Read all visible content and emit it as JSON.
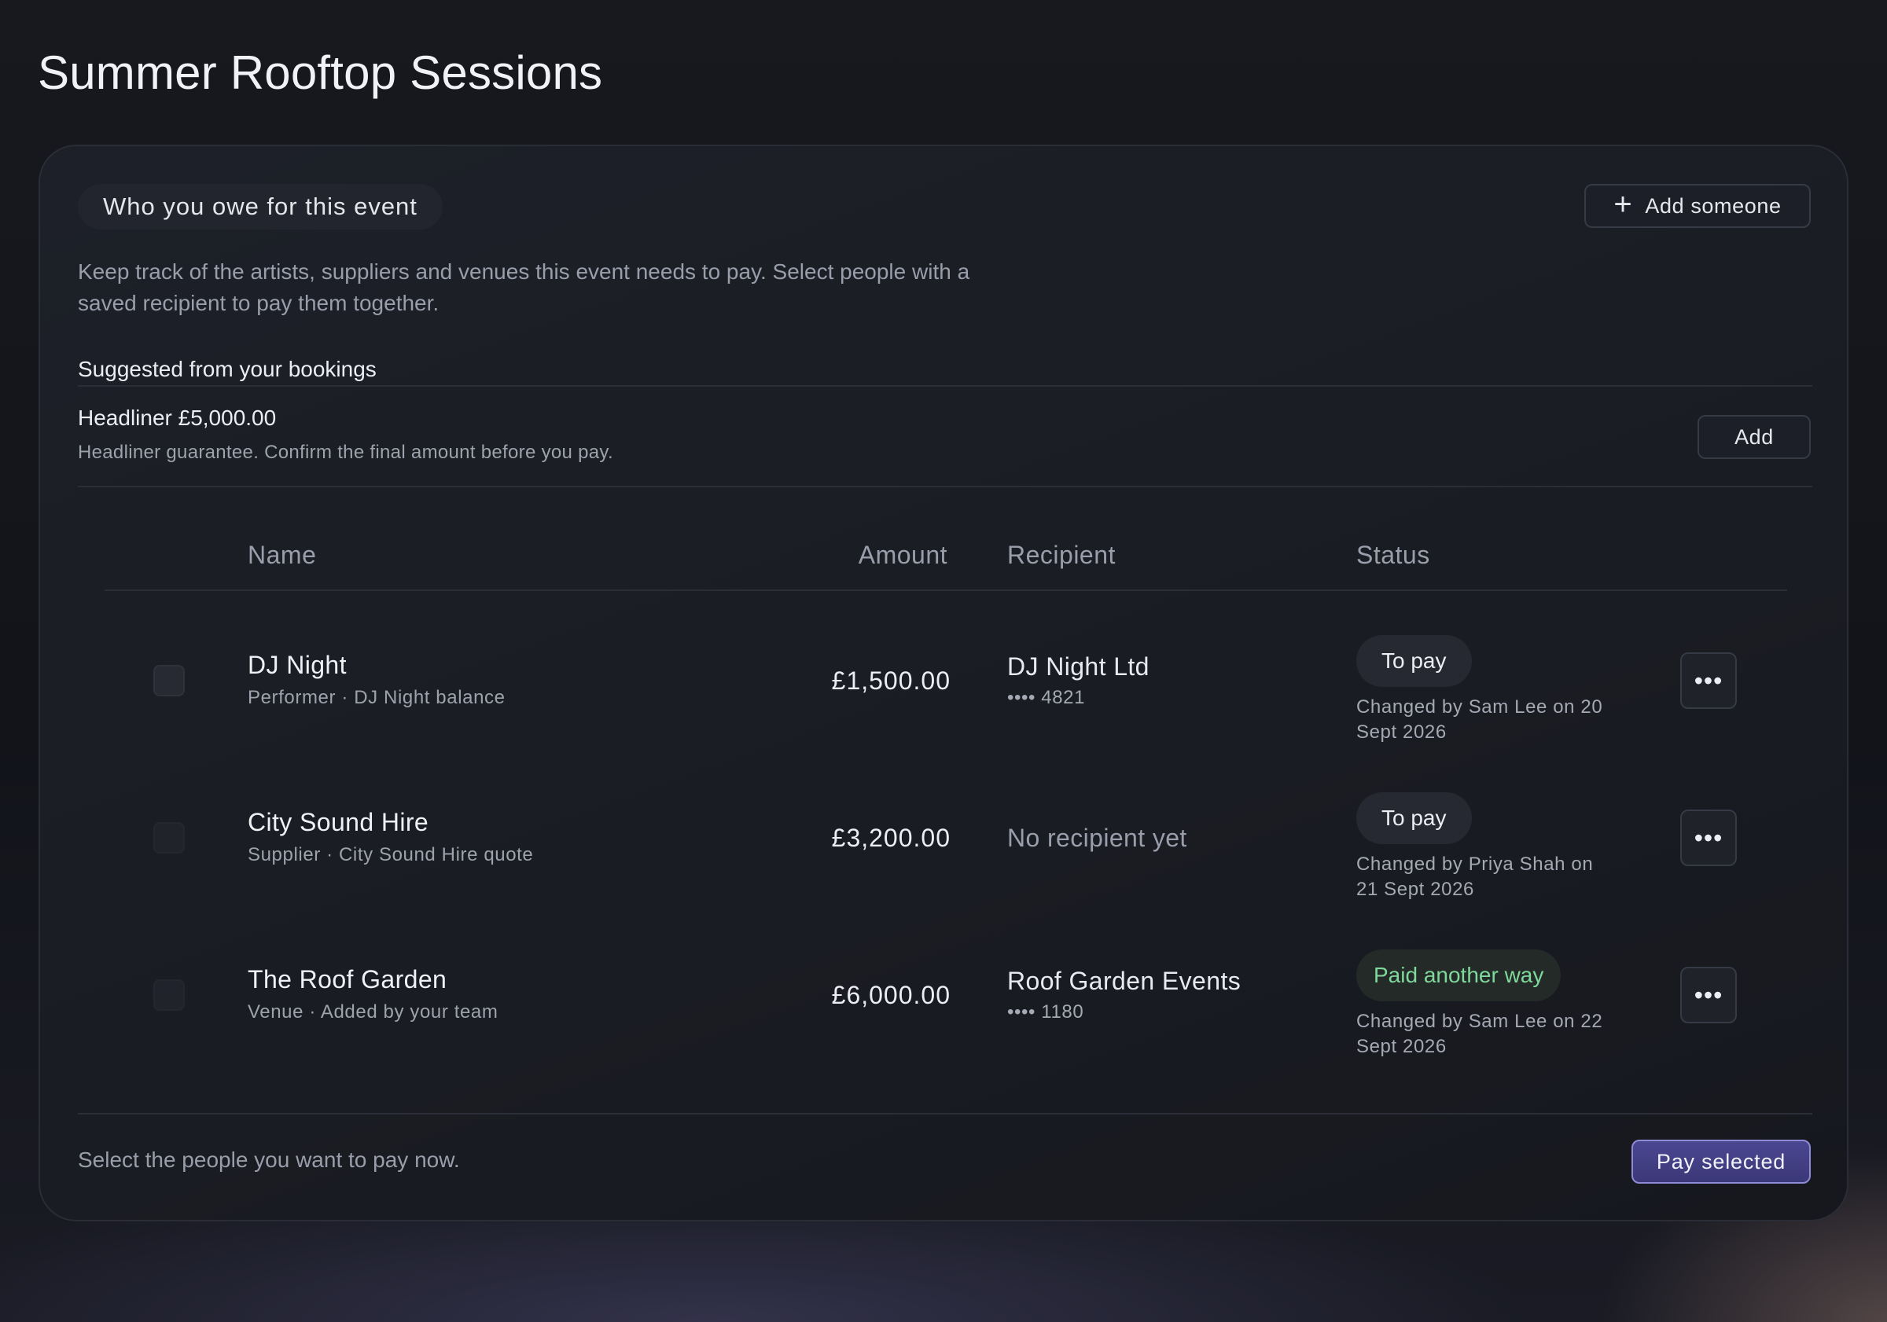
{
  "page": {
    "title": "Summer Rooftop Sessions"
  },
  "card": {
    "title": "Who you owe for this event",
    "add_someone_label": "Add someone",
    "description": "Keep track of the artists, suppliers and venues this event needs to pay. Select people with a saved recipient to pay them together."
  },
  "suggestions": {
    "heading": "Suggested from your bookings",
    "items": [
      {
        "title": "Headliner £5,000.00",
        "subtitle": "Headliner guarantee. Confirm the final amount before you pay.",
        "add_label": "Add"
      }
    ]
  },
  "table": {
    "headers": {
      "name": "Name",
      "amount": "Amount",
      "recipient": "Recipient",
      "status": "Status"
    },
    "rows": [
      {
        "name": "DJ Night",
        "subtitle": "Performer · DJ Night balance",
        "amount": "£1,500.00",
        "recipient": "DJ Night Ltd",
        "account": "•••• 4821",
        "status": "To pay",
        "status_color": "#eceef3",
        "changed": "Changed by Sam Lee on 20 Sept 2026",
        "more_label": "•••",
        "checked": false
      },
      {
        "name": "City Sound Hire",
        "subtitle": "Supplier · City Sound Hire quote",
        "amount": "£3,200.00",
        "recipient": "No recipient yet",
        "account": "",
        "status": "To pay",
        "status_color": "#eceef3",
        "changed": "Changed by Priya Shah on 21 Sept 2026",
        "more_label": "•••",
        "checked": false
      },
      {
        "name": "The Roof Garden",
        "subtitle": "Venue · Added by your team",
        "amount": "£6,000.00",
        "recipient": "Roof Garden Events",
        "account": "•••• 1180",
        "status": "Paid another way",
        "status_color": "#7fd89c",
        "changed": "Changed by Sam Lee on 22 Sept 2026",
        "more_label": "•••",
        "checked": false
      }
    ]
  },
  "footer": {
    "hint": "Select the people you want to pay now.",
    "pay_label": "Pay selected"
  },
  "colors": {
    "accent": "#4a4791",
    "paid_status": "#7fd89c",
    "background": "#15171d"
  }
}
